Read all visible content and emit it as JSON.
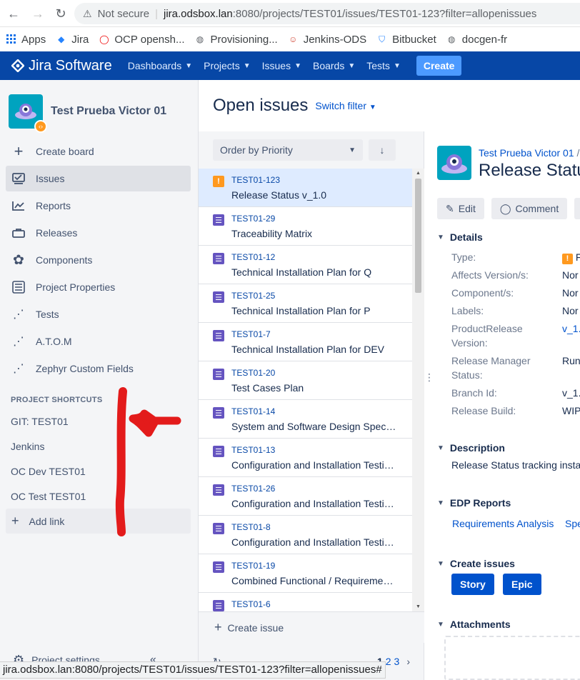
{
  "browser": {
    "warning": "Not secure",
    "url_host": "jira.odsbox.lan",
    "url_rest": ":8080/projects/TEST01/issues/TEST01-123?filter=allopenissues",
    "status_url": "jira.odsbox.lan:8080/projects/TEST01/issues/TEST01-123?filter=allopenissues#"
  },
  "bookmarks": [
    {
      "label": "Apps",
      "icon": "apps-grid-icon"
    },
    {
      "label": "Jira",
      "icon": "jira-icon"
    },
    {
      "label": "OCP opensh...",
      "icon": "openshift-icon"
    },
    {
      "label": "Provisioning...",
      "icon": "globe-icon"
    },
    {
      "label": "Jenkins-ODS",
      "icon": "jenkins-icon"
    },
    {
      "label": "Bitbucket",
      "icon": "bitbucket-icon"
    },
    {
      "label": "docgen-fr",
      "icon": "globe-icon"
    }
  ],
  "topnav": {
    "logo_text": "Jira Software",
    "items": [
      "Dashboards",
      "Projects",
      "Issues",
      "Boards",
      "Tests"
    ],
    "create": "Create"
  },
  "sidebar": {
    "project_name": "Test Prueba Victor 01",
    "items": [
      {
        "label": "Create board",
        "icon": "plus-icon"
      },
      {
        "label": "Issues",
        "icon": "issues-icon"
      },
      {
        "label": "Reports",
        "icon": "reports-icon"
      },
      {
        "label": "Releases",
        "icon": "releases-icon"
      },
      {
        "label": "Components",
        "icon": "components-icon"
      },
      {
        "label": "Project Properties",
        "icon": "properties-icon"
      },
      {
        "label": "Tests",
        "icon": "tests-icon"
      },
      {
        "label": "A.T.O.M",
        "icon": "atom-icon"
      },
      {
        "label": "Zephyr Custom Fields",
        "icon": "zephyr-icon"
      }
    ],
    "shortcuts_title": "PROJECT SHORTCUTS",
    "shortcuts": [
      "GIT: TEST01",
      "Jenkins",
      "OC Dev TEST01",
      "OC Test TEST01"
    ],
    "add_link": "Add link",
    "footer": "Project settings"
  },
  "issues": {
    "title": "Open issues",
    "switch_filter": "Switch filter",
    "order_by": "Order by Priority",
    "list": [
      {
        "key": "TEST01-123",
        "summary": "Release Status v_1.0",
        "type": "priority"
      },
      {
        "key": "TEST01-29",
        "summary": "Traceability Matrix",
        "type": "doc"
      },
      {
        "key": "TEST01-12",
        "summary": "Technical Installation Plan for Q",
        "type": "doc"
      },
      {
        "key": "TEST01-25",
        "summary": "Technical Installation Plan for P",
        "type": "doc"
      },
      {
        "key": "TEST01-7",
        "summary": "Technical Installation Plan for DEV",
        "type": "doc"
      },
      {
        "key": "TEST01-20",
        "summary": "Test Cases Plan",
        "type": "doc"
      },
      {
        "key": "TEST01-14",
        "summary": "System and Software Design Spec…",
        "type": "doc"
      },
      {
        "key": "TEST01-13",
        "summary": "Configuration and Installation Testi…",
        "type": "doc"
      },
      {
        "key": "TEST01-26",
        "summary": "Configuration and Installation Testi…",
        "type": "doc"
      },
      {
        "key": "TEST01-8",
        "summary": "Configuration and Installation Testi…",
        "type": "doc"
      },
      {
        "key": "TEST01-19",
        "summary": "Combined Functional / Requireme…",
        "type": "doc"
      },
      {
        "key": "TEST01-6",
        "summary": "",
        "type": "doc"
      }
    ],
    "create_issue": "Create issue",
    "pages": [
      "1",
      "2",
      "3"
    ],
    "page_next": "›"
  },
  "detail": {
    "project_link": "Test Prueba Victor 01",
    "breadcrumb_sep": "/",
    "title": "Release Status",
    "edit": "Edit",
    "comment": "Comment",
    "details_title": "Details",
    "fields": [
      {
        "label": "Type:",
        "value": "F"
      },
      {
        "label": "Affects Version/s:",
        "value": "Nor"
      },
      {
        "label": "Component/s:",
        "value": "Nor"
      },
      {
        "label": "Labels:",
        "value": "Nor"
      },
      {
        "label": "ProductRelease Version:",
        "value": "v_1."
      },
      {
        "label": "Release Manager Status:",
        "value": "Run"
      },
      {
        "label": "Branch Id:",
        "value": "v_1."
      },
      {
        "label": "Release Build:",
        "value": "WIP"
      }
    ],
    "description_title": "Description",
    "description": "Release Status tracking insta",
    "edp_title": "EDP Reports",
    "edp_links": [
      "Requirements Analysis",
      "Spe"
    ],
    "create_issues_title": "Create issues",
    "story": "Story",
    "epic": "Epic",
    "attachments_title": "Attachments"
  },
  "colors": {
    "nav_bg": "#0747a6",
    "accent": "#0052cc",
    "annotation": "#e31b1b",
    "priority": "#ff991f",
    "doc_type": "#6554c0"
  }
}
